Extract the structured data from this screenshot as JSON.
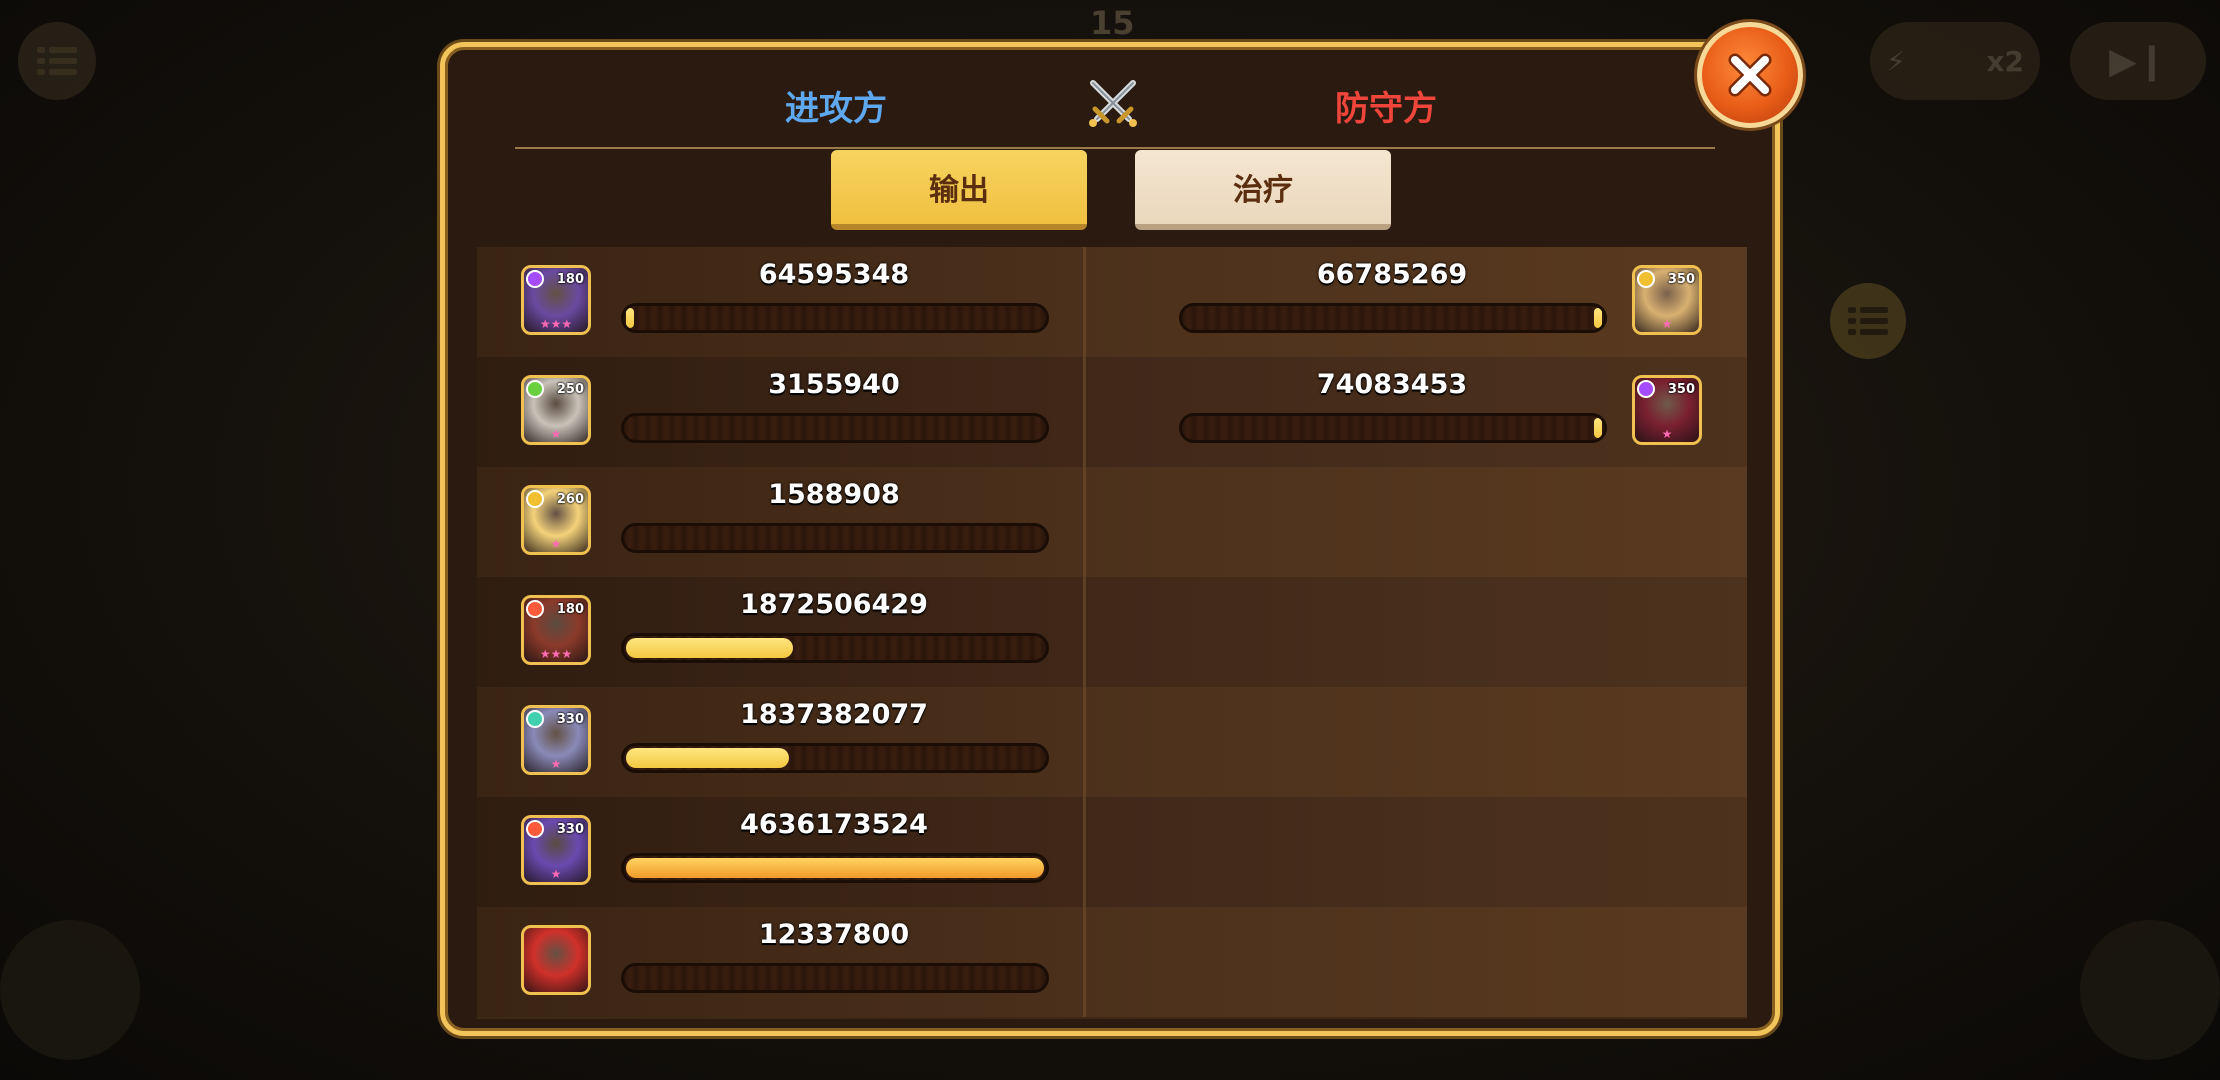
{
  "background": {
    "turn_counter": "15",
    "speed_label": "x2"
  },
  "header": {
    "attacker_label": "进攻方",
    "defender_label": "防守方"
  },
  "tabs": {
    "output_label": "输出",
    "heal_label": "治疗"
  },
  "attackers": [
    {
      "level": "180",
      "value": "64595348",
      "fill_fraction": 0.01,
      "element_color": "#a64cff",
      "portrait_color": "#6a4aa0",
      "stars": "★★★"
    },
    {
      "level": "250",
      "value": "3155940",
      "fill_fraction": 0.0,
      "element_color": "#6ad040",
      "portrait_color": "#c9c2b8",
      "stars": "★"
    },
    {
      "level": "260",
      "value": "1588908",
      "fill_fraction": 0.0,
      "element_color": "#f0c030",
      "portrait_color": "#f4d27a",
      "stars": "★"
    },
    {
      "level": "180",
      "value": "1872506429",
      "fill_fraction": 0.4,
      "element_color": "#ff5a3a",
      "portrait_color": "#8a3a2a",
      "stars": "★★★"
    },
    {
      "level": "330",
      "value": "1837382077",
      "fill_fraction": 0.39,
      "element_color": "#40d0b0",
      "portrait_color": "#8a8ab8",
      "stars": "★"
    },
    {
      "level": "330",
      "value": "4636173524",
      "fill_fraction": 1.0,
      "element_color": "#ff5a3a",
      "portrait_color": "#6a4ab0",
      "stars": "★"
    },
    {
      "level": "",
      "value": "12337800",
      "fill_fraction": 0.0,
      "element_color": "",
      "portrait_color": "#d0302a",
      "stars": ""
    }
  ],
  "defenders": [
    {
      "level": "350",
      "value": "66785269",
      "fill_fraction": 0.02,
      "element_color": "#f0c030",
      "portrait_color": "#d8b070",
      "stars": "★"
    },
    {
      "level": "350",
      "value": "74083453",
      "fill_fraction": 0.02,
      "element_color": "#a64cff",
      "portrait_color": "#7a2030",
      "stars": "★"
    }
  ],
  "colors": {
    "attacker": "#5ea8f0",
    "defender": "#f0453a",
    "panel_border": "#f2c45a"
  }
}
